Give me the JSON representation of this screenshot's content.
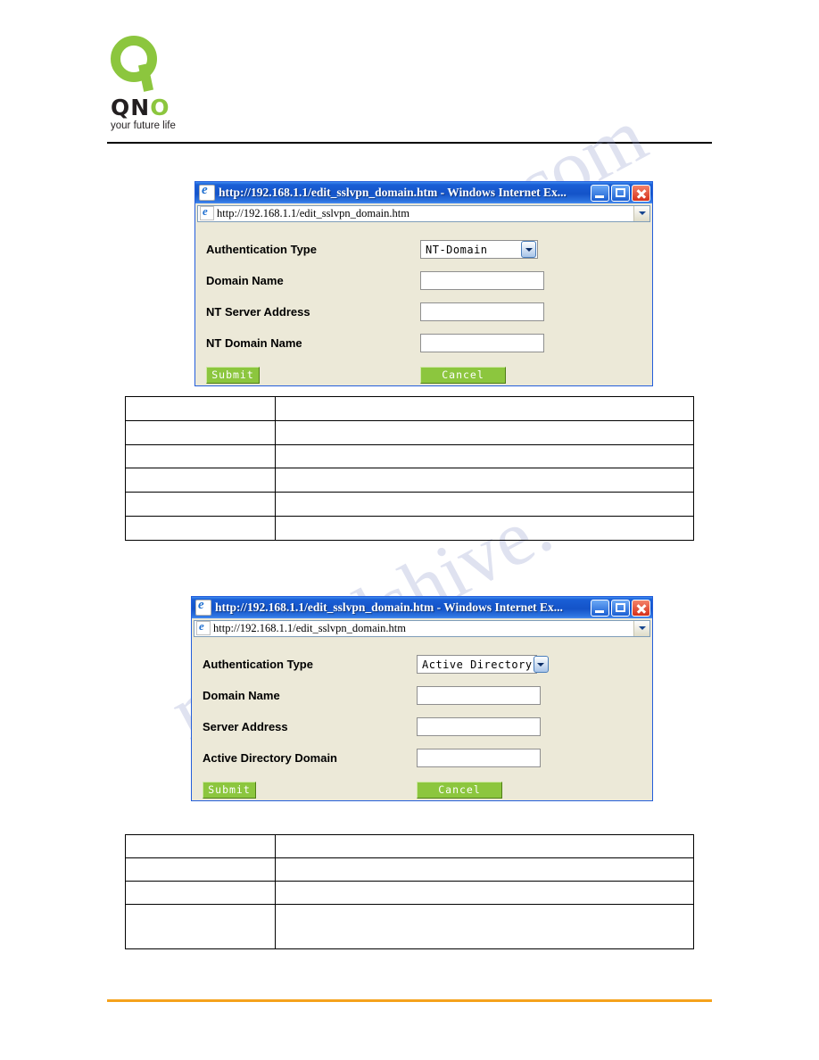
{
  "logo": {
    "word_left": "QN",
    "word_o": "O",
    "tagline": "your future life"
  },
  "watermark": {
    "line1": "uals.com",
    "line2": "manualshive."
  },
  "window1": {
    "title": "http://192.168.1.1/edit_sslvpn_domain.htm - Windows Internet Ex...",
    "address": "http://192.168.1.1/edit_sslvpn_domain.htm",
    "icon_minimize": "minimize-icon",
    "icon_maximize": "maximize-icon",
    "icon_close": "close-icon",
    "fields": [
      {
        "label": "Authentication Type",
        "value": "NT-Domain",
        "type": "select"
      },
      {
        "label": "Domain Name",
        "value": "",
        "type": "text"
      },
      {
        "label": "NT Server Address",
        "value": "",
        "type": "text"
      },
      {
        "label": "NT Domain Name",
        "value": "",
        "type": "text"
      }
    ],
    "submit_label": "Submit",
    "cancel_label": "Cancel"
  },
  "window2": {
    "title": "http://192.168.1.1/edit_sslvpn_domain.htm - Windows Internet Ex...",
    "address": "http://192.168.1.1/edit_sslvpn_domain.htm",
    "icon_minimize": "minimize-icon",
    "icon_maximize": "maximize-icon",
    "icon_close": "close-icon",
    "fields": [
      {
        "label": "Authentication Type",
        "value": "Active Directory",
        "type": "select"
      },
      {
        "label": "Domain Name",
        "value": "",
        "type": "text"
      },
      {
        "label": "Server Address",
        "value": "",
        "type": "text"
      },
      {
        "label": "Active Directory Domain",
        "value": "",
        "type": "text"
      }
    ],
    "submit_label": "Submit",
    "cancel_label": "Cancel"
  },
  "table1": {
    "rows": [
      {
        "col1": "",
        "col2": ""
      },
      {
        "col1": "",
        "col2": ""
      },
      {
        "col1": "",
        "col2": ""
      },
      {
        "col1": "",
        "col2": ""
      },
      {
        "col1": "",
        "col2": ""
      },
      {
        "col1": "",
        "col2": ""
      }
    ]
  },
  "table2": {
    "rows": [
      {
        "col1": "",
        "col2": ""
      },
      {
        "col1": "",
        "col2": ""
      },
      {
        "col1": "",
        "col2": ""
      },
      {
        "col1": "",
        "col2": ""
      }
    ]
  }
}
